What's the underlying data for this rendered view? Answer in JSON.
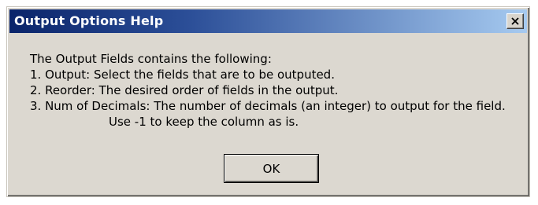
{
  "window": {
    "title": "Output Options Help",
    "close_icon": "close-x-icon"
  },
  "message": {
    "lines": [
      "The Output Fields contains the following:",
      "1. Output: Select the fields that are to be outputed.",
      "2. Reorder: The desired order of fields in the output.",
      "3. Num of Decimals: The number of decimals (an integer) to output for the field.",
      "Use -1 to keep the column as is."
    ]
  },
  "buttons": {
    "ok_label": "OK"
  },
  "colors": {
    "titlebar_start": "#0a246a",
    "titlebar_end": "#a6caf0",
    "dialog_background": "#dcd8d0"
  }
}
